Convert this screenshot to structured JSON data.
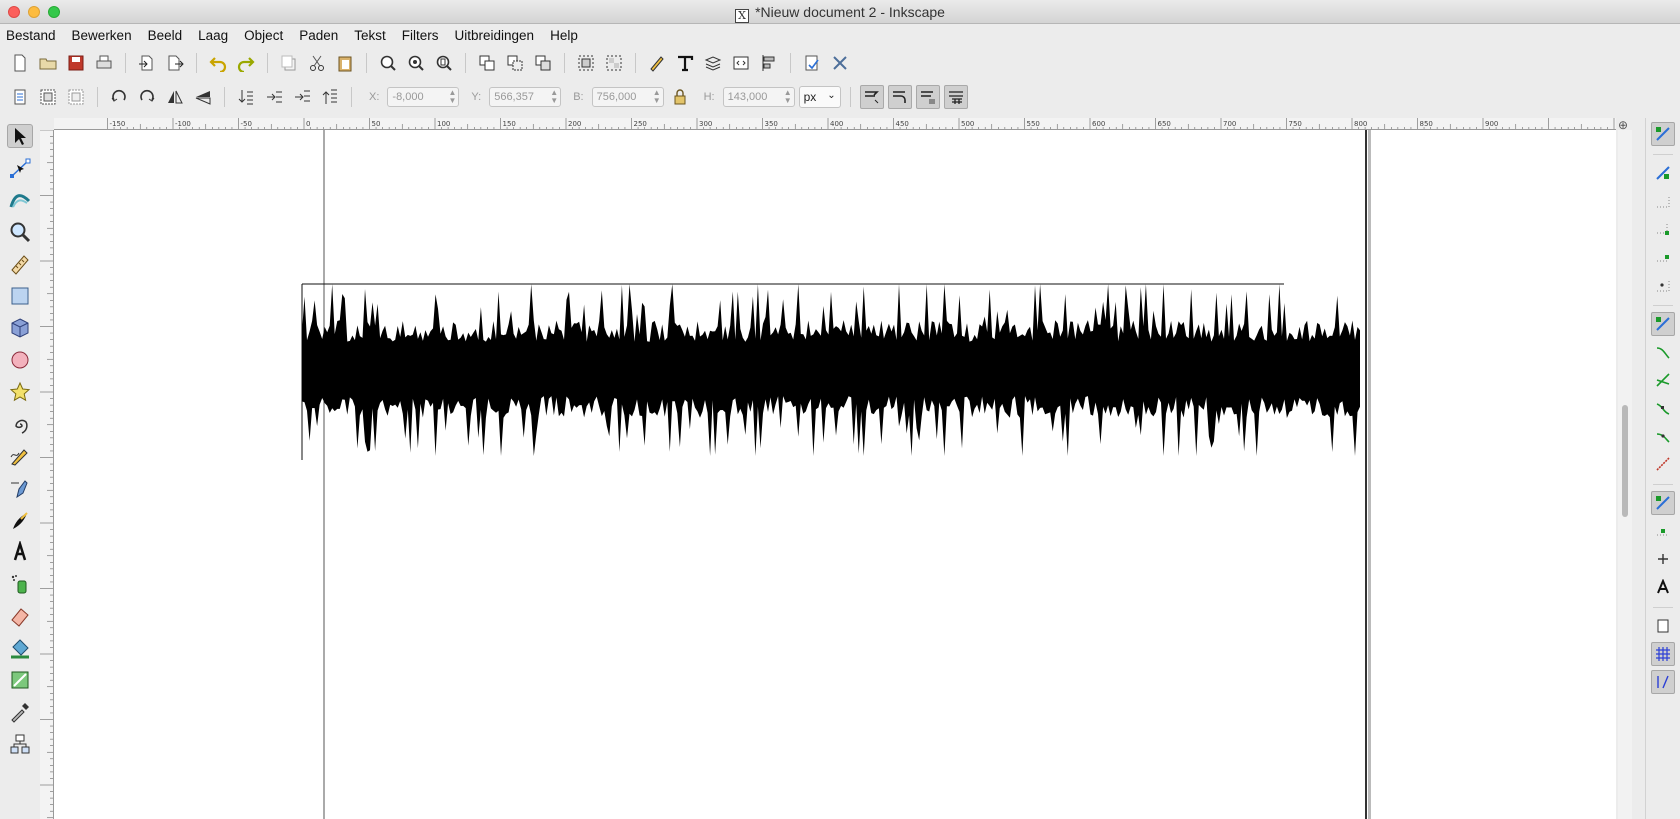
{
  "window": {
    "title": "*Nieuw document 2 - Inkscape"
  },
  "menu": {
    "items": [
      "Bestand",
      "Bewerken",
      "Beeld",
      "Laag",
      "Object",
      "Paden",
      "Tekst",
      "Filters",
      "Uitbreidingen",
      "Help"
    ]
  },
  "controls": {
    "x_label": "X:",
    "x_value": "-8,000",
    "y_label": "Y:",
    "y_value": "566,357",
    "w_label": "B:",
    "w_value": "756,000",
    "h_label": "H:",
    "h_value": "143,000",
    "unit": "px"
  },
  "ruler": {
    "labels": [
      "-150",
      "-100",
      "-50",
      "0",
      "50",
      "100",
      "150",
      "200",
      "250",
      "300",
      "350",
      "400",
      "450",
      "500",
      "550",
      "600",
      "650",
      "700",
      "750",
      "800",
      "850",
      "900"
    ]
  },
  "colors": {
    "accent": "#2b6fd6",
    "snap_green": "#1a9a2a"
  },
  "icons": {
    "tools": [
      "selector-icon",
      "node-icon",
      "tweak-icon",
      "zoom-icon",
      "measure-icon",
      "rectangle-icon",
      "3d-box-icon",
      "ellipse-icon",
      "star-icon",
      "spiral-icon",
      "pencil-icon",
      "pen-icon",
      "calligraphy-icon",
      "text-icon",
      "spray-icon",
      "eraser-icon",
      "paint-bucket-icon",
      "gradient-icon",
      "dropper-icon",
      "connector-icon"
    ]
  }
}
